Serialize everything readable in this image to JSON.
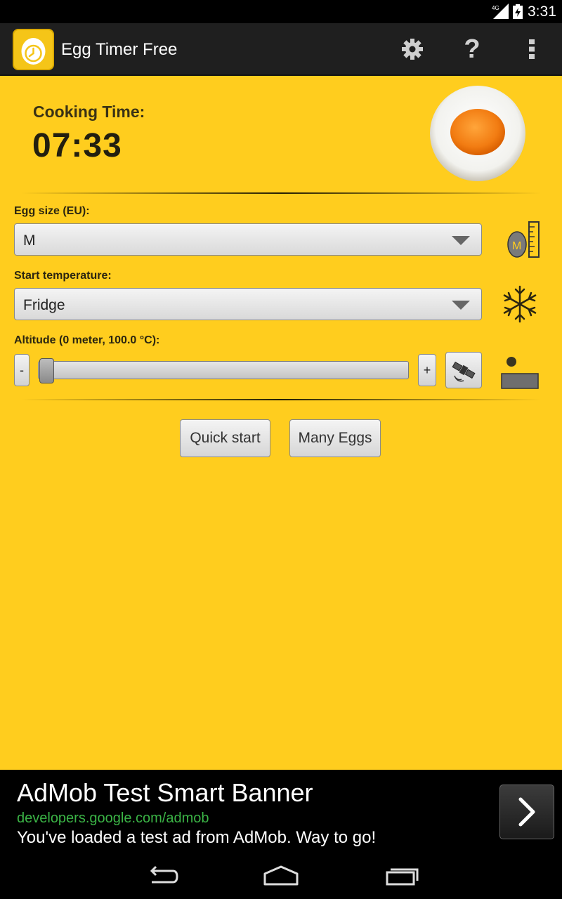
{
  "status_bar": {
    "network": "4G",
    "time": "3:31",
    "icons": [
      "signal-icon",
      "battery-charging-icon"
    ]
  },
  "action_bar": {
    "title": "Egg Timer Free",
    "icons": [
      "app-egg-clock-icon",
      "settings-gear-icon",
      "help-question-icon",
      "overflow-menu-icon"
    ],
    "help_glyph": "?"
  },
  "cooking": {
    "label": "Cooking Time:",
    "time": "07:33"
  },
  "egg_size": {
    "label": "Egg size (EU):",
    "selected": "M",
    "icon_letter": "M"
  },
  "start_temp": {
    "label": "Start temperature:",
    "selected": "Fridge"
  },
  "altitude": {
    "label": "Altitude (0 meter, 100.0 °C):",
    "minus_label": "-",
    "plus_label": "+",
    "slider_value_fraction": 0.0
  },
  "buttons": {
    "quick_start": "Quick start",
    "many_eggs": "Many Eggs"
  },
  "ad": {
    "title": "AdMob Test Smart Banner",
    "url": "developers.google.com/admob",
    "description": "You've loaded a test ad from AdMob. Way to go!"
  },
  "colors": {
    "background": "#ffcd1e",
    "ad_url": "#3bb446",
    "action_bar": "#1f1f1f"
  }
}
